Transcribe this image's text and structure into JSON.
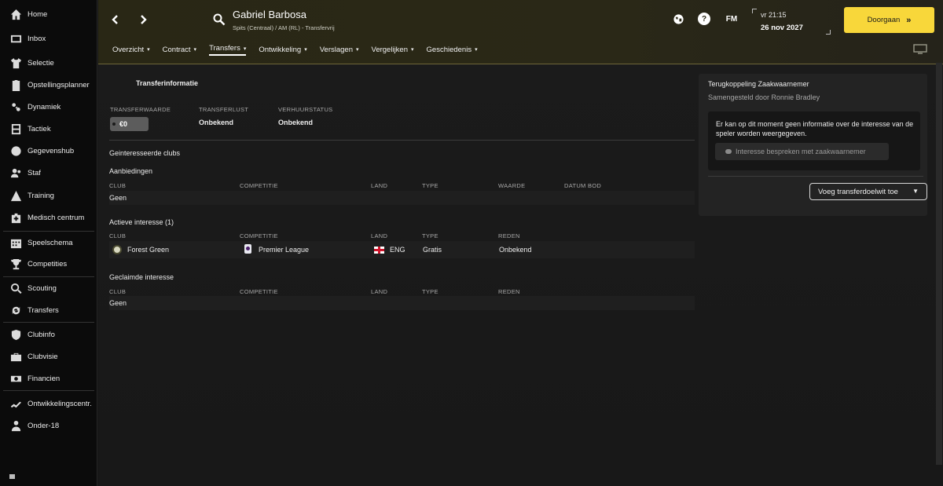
{
  "sidebar": {
    "items": [
      {
        "label": "Home",
        "icon": "home-icon"
      },
      {
        "label": "Inbox",
        "icon": "inbox-icon"
      },
      {
        "label": "Selectie",
        "icon": "shirt-icon"
      },
      {
        "label": "Opstellingsplanner",
        "icon": "clipboard-icon"
      },
      {
        "label": "Dynamiek",
        "icon": "dynamics-icon"
      },
      {
        "label": "Tactiek",
        "icon": "tactics-icon"
      },
      {
        "label": "Gegevenshub",
        "icon": "data-hub-icon"
      },
      {
        "label": "Staf",
        "icon": "staff-icon"
      },
      {
        "label": "Training",
        "icon": "training-icon"
      },
      {
        "label": "Medisch centrum",
        "icon": "medical-icon"
      },
      {
        "label": "Speelschema",
        "icon": "calendar-icon"
      },
      {
        "label": "Competities",
        "icon": "trophy-icon"
      },
      {
        "label": "Scouting",
        "icon": "scouting-icon"
      },
      {
        "label": "Transfers",
        "icon": "transfers-icon"
      },
      {
        "label": "Clubinfo",
        "icon": "shield-icon"
      },
      {
        "label": "Clubvisie",
        "icon": "briefcase-icon"
      },
      {
        "label": "Financien",
        "icon": "money-icon"
      },
      {
        "label": "Ontwikkelingscentr.",
        "icon": "development-icon"
      },
      {
        "label": "Onder-18",
        "icon": "youth-icon"
      }
    ]
  },
  "header": {
    "player_name": "Gabriel Barbosa",
    "player_subtitle": "Spits (Centraal) / AM (RL) - Transfervrij",
    "time": "vr 21:15",
    "date": "26 nov 2027",
    "continue_label": "Doorgaan",
    "fm_label": "FM",
    "help_label": "?",
    "tabs": [
      {
        "label": "Overzicht",
        "active": false
      },
      {
        "label": "Contract",
        "active": false
      },
      {
        "label": "Transfers",
        "active": true
      },
      {
        "label": "Ontwikkeling",
        "active": false
      },
      {
        "label": "Verslagen",
        "active": false
      },
      {
        "label": "Vergelijken",
        "active": false
      },
      {
        "label": "Geschiedenis",
        "active": false
      }
    ]
  },
  "transfer_info": {
    "title": "Transferinformatie",
    "value_label": "TRANSFERWAARDE",
    "value": "€0",
    "interest_label": "TRANSFERLUST",
    "interest_value": "Onbekend",
    "loan_label": "VERHUURSTATUS",
    "loan_value": "Onbekend"
  },
  "interested": {
    "title": "Geinteresseerde clubs",
    "offers": {
      "title": "Aanbiedingen",
      "columns": [
        "CLUB",
        "COMPETITIE",
        "LAND",
        "TYPE",
        "WAARDE",
        "DATUM BOD"
      ],
      "empty": "Geen"
    },
    "active": {
      "title": "Actieve interesse (1)",
      "columns": [
        "CLUB",
        "COMPETITIE",
        "LAND",
        "TYPE",
        "REDEN"
      ],
      "rows": [
        {
          "club": "Forest Green",
          "competition": "Premier League",
          "country": "ENG",
          "type": "Gratis",
          "reason": "Onbekend"
        }
      ]
    },
    "claimed": {
      "title": "Geclaimde interesse",
      "columns": [
        "CLUB",
        "COMPETITIE",
        "LAND",
        "TYPE",
        "REDEN"
      ],
      "empty": "Geen"
    }
  },
  "agent": {
    "title": "Terugkoppeling Zaakwaarnemer",
    "subtitle": "Samengesteld door Ronnie Bradley",
    "message": "Er kan op dit moment geen informatie over de interesse van de speler worden weergegeven.",
    "discuss_button": "Interesse bespreken met zaakwaarnemer",
    "target_button": "Voeg transferdoelwit toe"
  },
  "colors": {
    "accent": "#f8d73a",
    "sidebar_bg": "#0b0b0b",
    "header_bg": "#292715"
  }
}
